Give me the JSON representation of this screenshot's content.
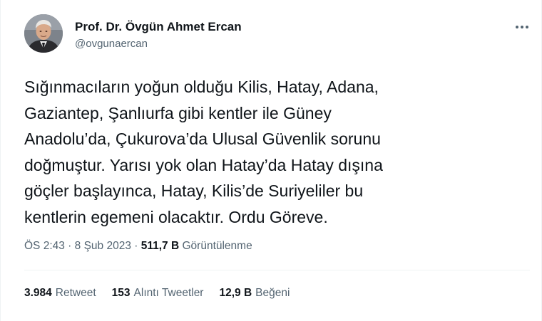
{
  "author": {
    "name": "Prof. Dr. Övgün Ahmet Ercan",
    "handle": "@ovgunaercan"
  },
  "tweet": {
    "lines": [
      "Sığınmacıların yoğun olduğu Kilis, Hatay, Adana,",
      "Gaziantep, Şanlıurfa gibi kentler ile Güney",
      "Anadolu’da, Çukurova’da Ulusal Güvenlik sorunu",
      "doğmuştur. Yarısı yok olan Hatay’da Hatay dışına",
      "göçler başlayınca, Hatay, Kilis’de Suriyeliler bu",
      "kentlerin egemeni olacaktır. Ordu Göreve."
    ]
  },
  "meta": {
    "time": "ÖS 2:43",
    "separator1": " · ",
    "date": "8 Şub 2023",
    "separator2": " · ",
    "views_count": "511,7 B",
    "views_label": "Görüntülenme"
  },
  "stats": {
    "retweets_count": "3.984",
    "retweets_label": "Retweet",
    "quotes_count": "153",
    "quotes_label": "Alıntı Tweetler",
    "likes_count": "12,9 B",
    "likes_label": "Beğeni"
  },
  "icons": {
    "more": "more-horizontal-icon"
  },
  "colors": {
    "text_primary": "#0f1419",
    "text_secondary": "#536471",
    "divider": "#eff3f4"
  }
}
